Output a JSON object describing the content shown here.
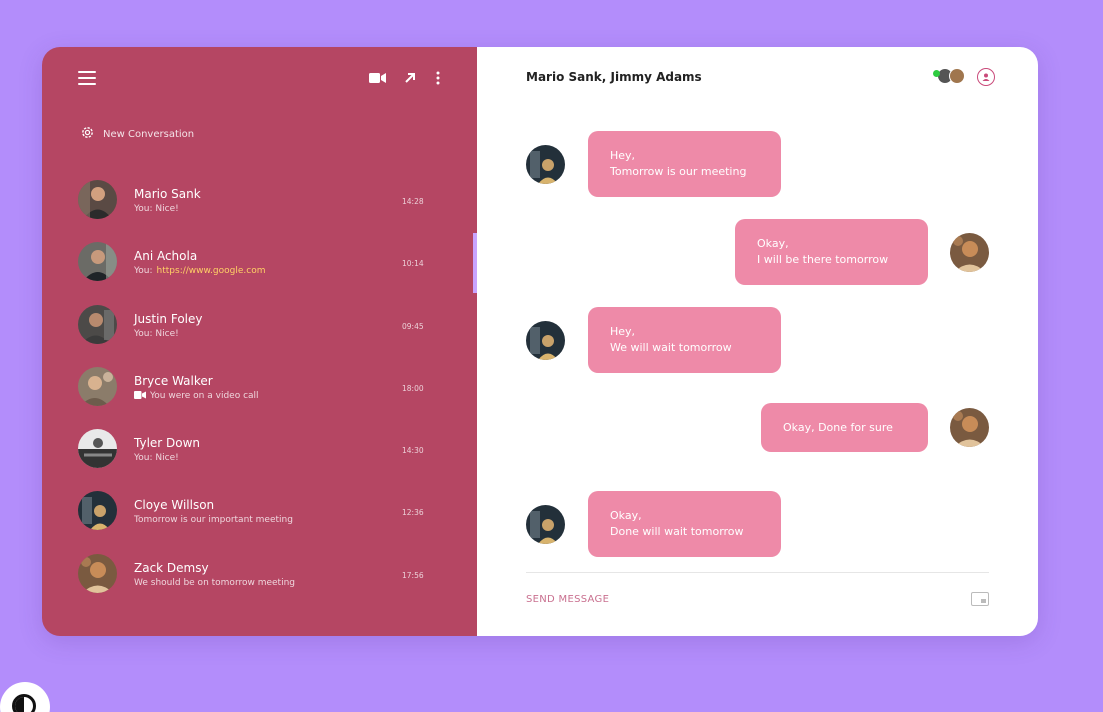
{
  "sidebar": {
    "new_conversation_label": "New Conversation",
    "conversations": [
      {
        "name": "Mario Sank",
        "preview": "You: Nice!",
        "time": "14:28"
      },
      {
        "name": "Ani Achola",
        "preview_prefix": "You:",
        "preview_link": "https://www.google.com",
        "time": "10:14"
      },
      {
        "name": "Justin Foley",
        "preview": "You: Nice!",
        "time": "09:45"
      },
      {
        "name": "Bryce Walker",
        "preview": "You were on a video call",
        "time": "18:00"
      },
      {
        "name": "Tyler Down",
        "preview": "You: Nice!",
        "time": "14:30"
      },
      {
        "name": "Cloye Willson",
        "preview": "Tomorrow is our important meeting",
        "time": "12:36"
      },
      {
        "name": "Zack Demsy",
        "preview": "We should be on tomorrow meeting",
        "time": "17:56"
      }
    ]
  },
  "chat": {
    "title": "Mario Sank, Jimmy Adams",
    "messages": [
      {
        "side": "left",
        "line1": "Hey,",
        "line2": "Tomorrow is our meeting"
      },
      {
        "side": "right",
        "line1": "Okay,",
        "line2": "I will be there tomorrow"
      },
      {
        "side": "left",
        "line1": "Hey,",
        "line2": "We will wait tomorrow"
      },
      {
        "side": "right",
        "line1": "Okay, Done for sure",
        "line2": ""
      },
      {
        "side": "left",
        "line1": "Okay,",
        "line2": "Done will wait tomorrow"
      }
    ],
    "send_placeholder": "SEND MESSAGE"
  },
  "colors": {
    "background": "#b38dfb",
    "sidebar": "#b54663",
    "bubble": "#ee8aa8",
    "link": "#ffd166",
    "online": "#2ecc40"
  },
  "icons": [
    "menu-icon",
    "video-camera-icon",
    "arrow-up-right-icon",
    "more-vertical-icon",
    "gear-icon",
    "add-user-icon",
    "attachment-icon",
    "theme-toggle-icon"
  ]
}
